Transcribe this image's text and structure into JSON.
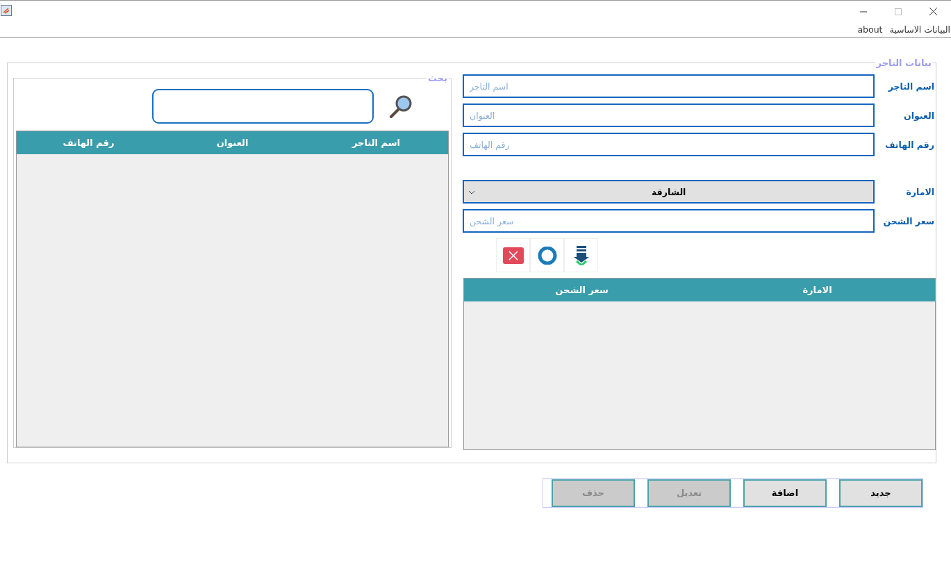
{
  "menu": [
    {
      "label": "البيانات الاساسية"
    },
    {
      "label": "about"
    }
  ],
  "merchant_panel": {
    "title": "بيانات التاجر",
    "fields": [
      {
        "kind": "text",
        "label": "اسم التاجر",
        "placeholder": "اسم التاجر"
      },
      {
        "kind": "text",
        "label": "العنوان",
        "placeholder": "العنوان"
      },
      {
        "kind": "text",
        "label": "رقم الهاتف",
        "placeholder": "رقم الهاتف"
      },
      {
        "kind": "dropdown",
        "label": "الامارة",
        "value": "الشارقة"
      },
      {
        "kind": "text",
        "label": "سعر الشحن",
        "placeholder": "سعر الشحن"
      }
    ],
    "rate_table": {
      "columns": [
        "الامارة",
        "سعر الشحن"
      ]
    }
  },
  "search_panel": {
    "title": "بحث",
    "table": {
      "columns": [
        "اسم التاجر",
        "العنوان",
        "رقم الهاتف"
      ]
    }
  },
  "buttons": [
    {
      "label": "جديد",
      "disabled": false
    },
    {
      "label": "اضافة",
      "disabled": false
    },
    {
      "label": "تعديل",
      "disabled": true
    },
    {
      "label": "حذف",
      "disabled": true
    }
  ]
}
